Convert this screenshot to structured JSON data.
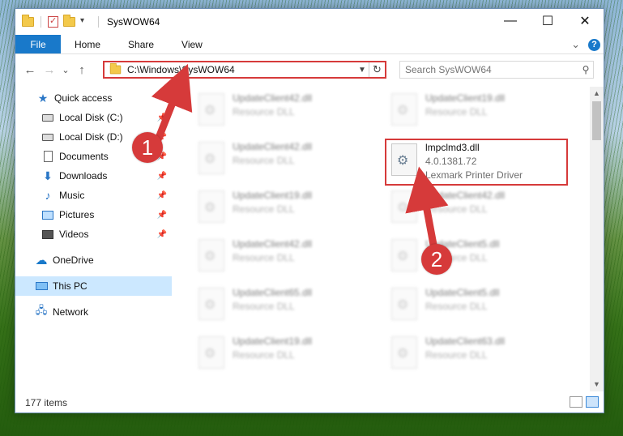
{
  "window": {
    "title": "SysWOW64",
    "minimize": "—",
    "maximize": "☐",
    "close": "✕"
  },
  "ribbon": {
    "tabs": [
      "File",
      "Home",
      "Share",
      "View"
    ],
    "expand_glyph": "⌄",
    "help_glyph": "?"
  },
  "nav": {
    "back": "←",
    "forward": "→",
    "recent": "⌄",
    "up": "↑",
    "address": "C:\\Windows\\SysWOW64",
    "search_placeholder": "Search SysWOW64"
  },
  "sidebar": {
    "items": [
      {
        "label": "Quick access",
        "icon": "star-icon",
        "pinned": false
      },
      {
        "label": "Local Disk (C:)",
        "icon": "drive-icon",
        "pinned": true
      },
      {
        "label": "Local Disk (D:)",
        "icon": "drive-icon",
        "pinned": true
      },
      {
        "label": "Documents",
        "icon": "document-icon",
        "pinned": true
      },
      {
        "label": "Downloads",
        "icon": "download-icon",
        "pinned": true
      },
      {
        "label": "Music",
        "icon": "music-icon",
        "pinned": true
      },
      {
        "label": "Pictures",
        "icon": "pictures-icon",
        "pinned": true
      },
      {
        "label": "Videos",
        "icon": "videos-icon",
        "pinned": true
      },
      {
        "label": "OneDrive",
        "icon": "cloud-icon",
        "pinned": false
      },
      {
        "label": "This PC",
        "icon": "pc-icon",
        "pinned": false,
        "selected": true
      },
      {
        "label": "Network",
        "icon": "network-icon",
        "pinned": false
      }
    ]
  },
  "files": {
    "left": [
      {
        "name": "UpdateClient42.dll",
        "type": "Resource DLL"
      },
      {
        "name": "UpdateClient42.dll",
        "type": "Resource DLL"
      },
      {
        "name": "UpdateClient19.dll",
        "type": "Resource DLL"
      },
      {
        "name": "UpdateClient42.dll",
        "type": "Resource DLL"
      },
      {
        "name": "UpdateClient65.dll",
        "type": "Resource DLL"
      },
      {
        "name": "UpdateClient19.dll",
        "type": "Resource DLL"
      }
    ],
    "right": [
      {
        "name": "UpdateClient19.dll",
        "type": "Resource DLL"
      },
      {
        "name": "UpdateClient42.dll",
        "type": "Resource DLL"
      },
      {
        "name": "UpdateClient5.dll",
        "type": "Resource DLL"
      },
      {
        "name": "UpdateClient5.dll",
        "type": "Resource DLL"
      },
      {
        "name": "UpdateClient63.dll",
        "type": "Resource DLL"
      }
    ],
    "highlighted": {
      "name": "lmpclmd3.dll",
      "version": "4.0.1381.72",
      "description": "Lexmark Printer Driver"
    }
  },
  "status": {
    "item_count": "177 items"
  },
  "annotations": {
    "badge1": "1",
    "badge2": "2",
    "color": "#d63a3a"
  }
}
